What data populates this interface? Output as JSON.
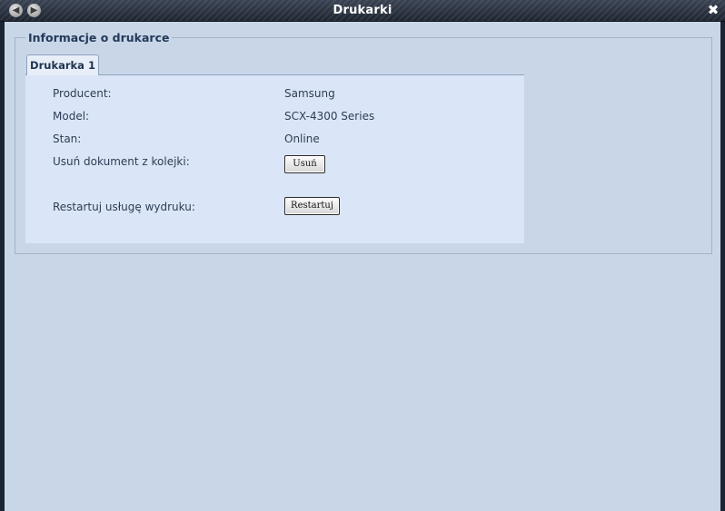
{
  "window": {
    "title": "Drukarki",
    "back_icon": "arrow-left-icon",
    "forward_icon": "arrow-right-icon",
    "close_icon": "close-icon"
  },
  "section": {
    "legend": "Informacje o drukarce"
  },
  "tabs": [
    {
      "label": "Drukarka 1",
      "active": true
    }
  ],
  "printer_info": {
    "manufacturer_label": "Producent:",
    "manufacturer_value": "Samsung",
    "model_label": "Model:",
    "model_value": "SCX-4300 Series",
    "status_label": "Stan:",
    "status_value": "Online",
    "remove_doc_label": "Usuń dokument z kolejki:",
    "remove_button": "Usuń",
    "restart_label": "Restartuj usługę wydruku:",
    "restart_button": "Restartuj"
  }
}
